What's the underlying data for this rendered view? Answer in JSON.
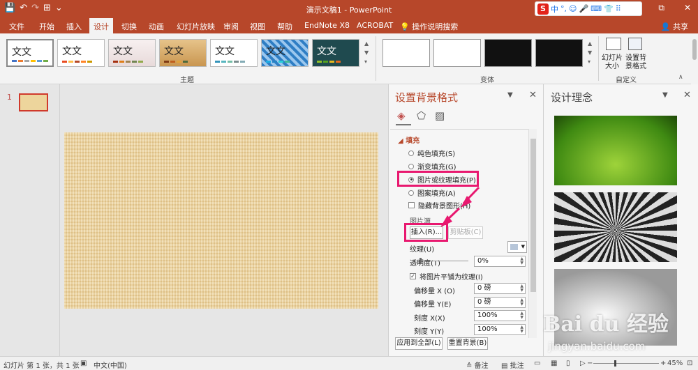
{
  "window": {
    "title": "演示文稿1 - PowerPoint"
  },
  "qat": {
    "save": "💾",
    "undo": "↶",
    "redo": "↷",
    "present": "⊞",
    "customize": "⌄"
  },
  "ime": {
    "logo": "S",
    "mode": "中",
    "items": [
      "°,",
      "☺",
      "🎤",
      "⌨",
      "👕",
      "⠿"
    ]
  },
  "winbuttons": {
    "restore": "⧉",
    "close": "✕"
  },
  "tabs": [
    "文件",
    "开始",
    "插入",
    "设计",
    "切换",
    "动画",
    "幻灯片放映",
    "审阅",
    "视图",
    "帮助",
    "EndNote X8",
    "ACROBAT"
  ],
  "tell_me": "操作说明搜索",
  "share": "共享",
  "ribbon": {
    "theme_sample": "文文",
    "theme_group": "主题",
    "variant_group": "变体",
    "custom_group": "自定义",
    "slide_size": "幻灯片\n大小",
    "bg_format": "设置背\n景格式",
    "theme_colors": [
      "#4472c4",
      "#ed7d31",
      "#a5a5a5",
      "#ffc000",
      "#5b9bd5",
      "#70ad47"
    ]
  },
  "slides": {
    "number": "1"
  },
  "format_pane": {
    "title": "设置背景格式",
    "fill_header": "填充",
    "options": [
      "纯色填充(S)",
      "渐变填充(G)",
      "图片或纹理填充(P)",
      "图案填充(A)"
    ],
    "hide_bg": "隐藏背景图形(H)",
    "pic_source": "图片源",
    "insert_btn": "插入(R)...",
    "clipboard_btn": "剪贴板(C)",
    "texture_label": "纹理(U)",
    "transparency_label": "透明度(T)",
    "transparency_value": "0%",
    "tile_label": "将图片平铺为纹理(I)",
    "offset_x_label": "偏移量 X (O)",
    "offset_x_value": "0 磅",
    "offset_y_label": "偏移量 Y(E)",
    "offset_y_value": "0 磅",
    "scale_x_label": "刻度 X(X)",
    "scale_x_value": "100%",
    "scale_y_label": "刻度 Y(Y)",
    "scale_y_value": "100%",
    "apply_all": "应用到全部(L)",
    "reset_bg": "重置背景(B)"
  },
  "design_pane": {
    "title": "设计理念",
    "watermark": "Bai du 经验",
    "watermark_url": "jingyan.baidu.com"
  },
  "status": {
    "slide_info": "幻灯片 第 1 张，共 1 张",
    "language": "中文(中国)",
    "notes": "备注",
    "comments": "批注",
    "zoom": "45%"
  }
}
